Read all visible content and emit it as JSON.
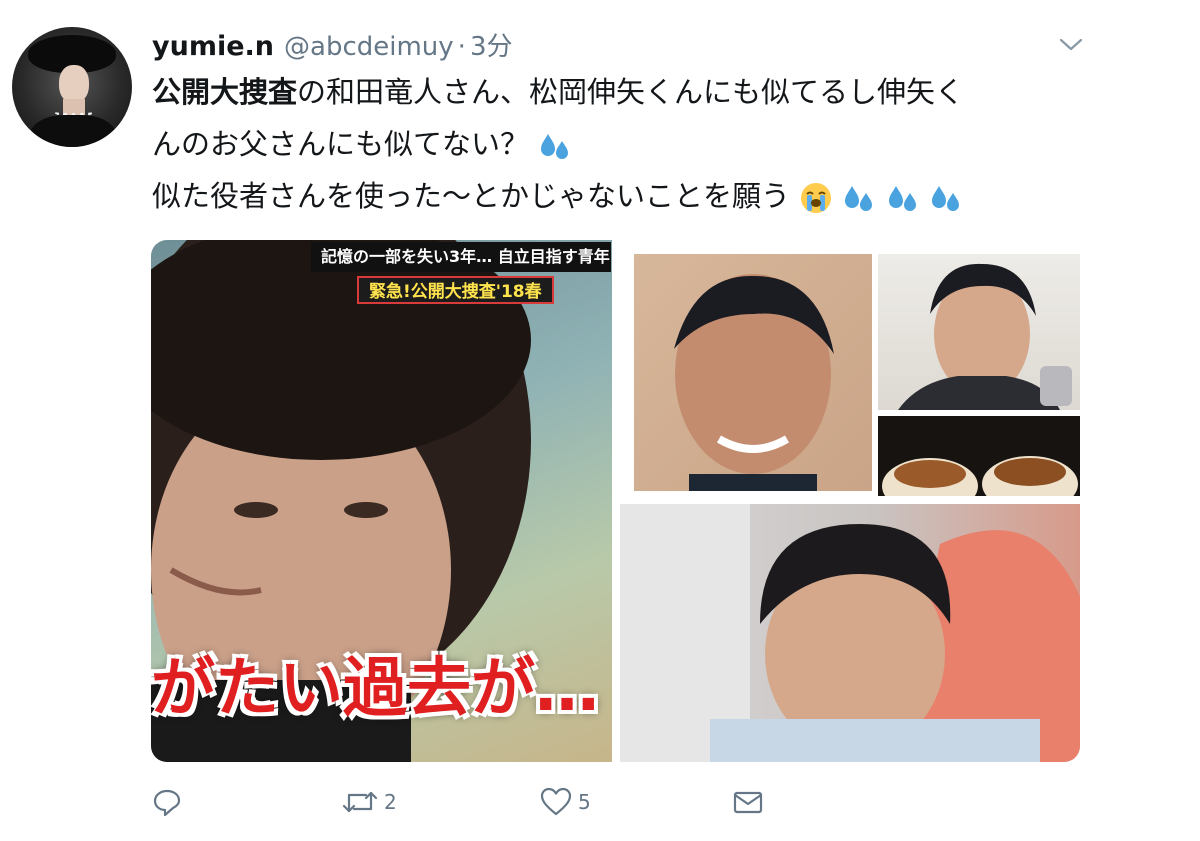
{
  "tweet": {
    "display_name": "yumie.n",
    "handle": "@abcdeimuy",
    "separator": "·",
    "time": "3分",
    "text": {
      "line1_bold": "公開大捜査",
      "line1_rest": "の和田竜人さん、松岡伸矢くんにも似てるし伸矢く",
      "line2": "んのお父さんにも似てない？",
      "line3": "似た役者さんを使った〜とかじゃないことを願う"
    },
    "emojis": {
      "sweat": "sweat-droplets-icon",
      "crying": "loudly-crying-face-icon"
    }
  },
  "media": {
    "left_image": {
      "caption_top": "記憶の一部を失い3年… 自立目指す青年",
      "caption_show": "緊急!公開大捜査'18春",
      "caption_bottom": "がたい過去が…"
    }
  },
  "actions": {
    "reply_icon": "reply-icon",
    "retweet_icon": "retweet-icon",
    "retweet_count": "2",
    "like_icon": "heart-icon",
    "like_count": "5",
    "dm_icon": "envelope-icon"
  },
  "colors": {
    "text_primary": "#14171a",
    "text_secondary": "#657786",
    "sweat_blue": "#4aa3df"
  }
}
